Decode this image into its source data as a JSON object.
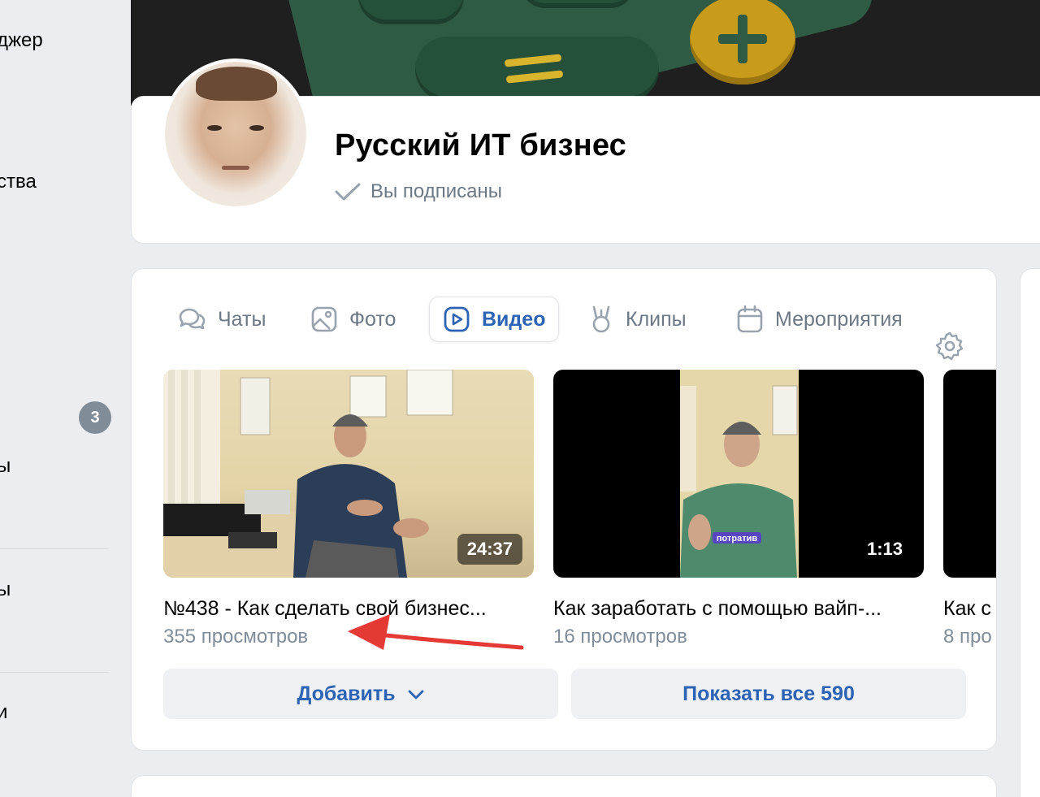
{
  "sidebar": {
    "items": [
      "джер",
      "ства",
      "ы",
      "ы",
      "и"
    ],
    "badge": "3"
  },
  "group": {
    "title": "Русский ИТ бизнес",
    "subscribed_label": "Вы подписаны"
  },
  "tabs": [
    {
      "label": "Чаты",
      "icon": "chat-icon",
      "active": false
    },
    {
      "label": "Фото",
      "icon": "photo-icon",
      "active": false
    },
    {
      "label": "Видео",
      "icon": "video-icon",
      "active": true
    },
    {
      "label": "Клипы",
      "icon": "clips-icon",
      "active": false
    },
    {
      "label": "Мероприятия",
      "icon": "calendar-icon",
      "active": false
    }
  ],
  "videos": [
    {
      "title": "№438 - Как сделать свой бизнес...",
      "views": "355 просмотров",
      "duration": "24:37"
    },
    {
      "title": "Как заработать с помощью вайп-...",
      "views": "16 просмотров",
      "duration": "1:13",
      "caption": "потратив"
    },
    {
      "title": "Как с",
      "views": "8 про"
    }
  ],
  "buttons": {
    "add_label": "Добавить",
    "show_all_label": "Показать все 590"
  },
  "colors": {
    "accent": "#2c63b4",
    "secondary_text": "#818c99",
    "annotation_arrow": "#e53935"
  }
}
